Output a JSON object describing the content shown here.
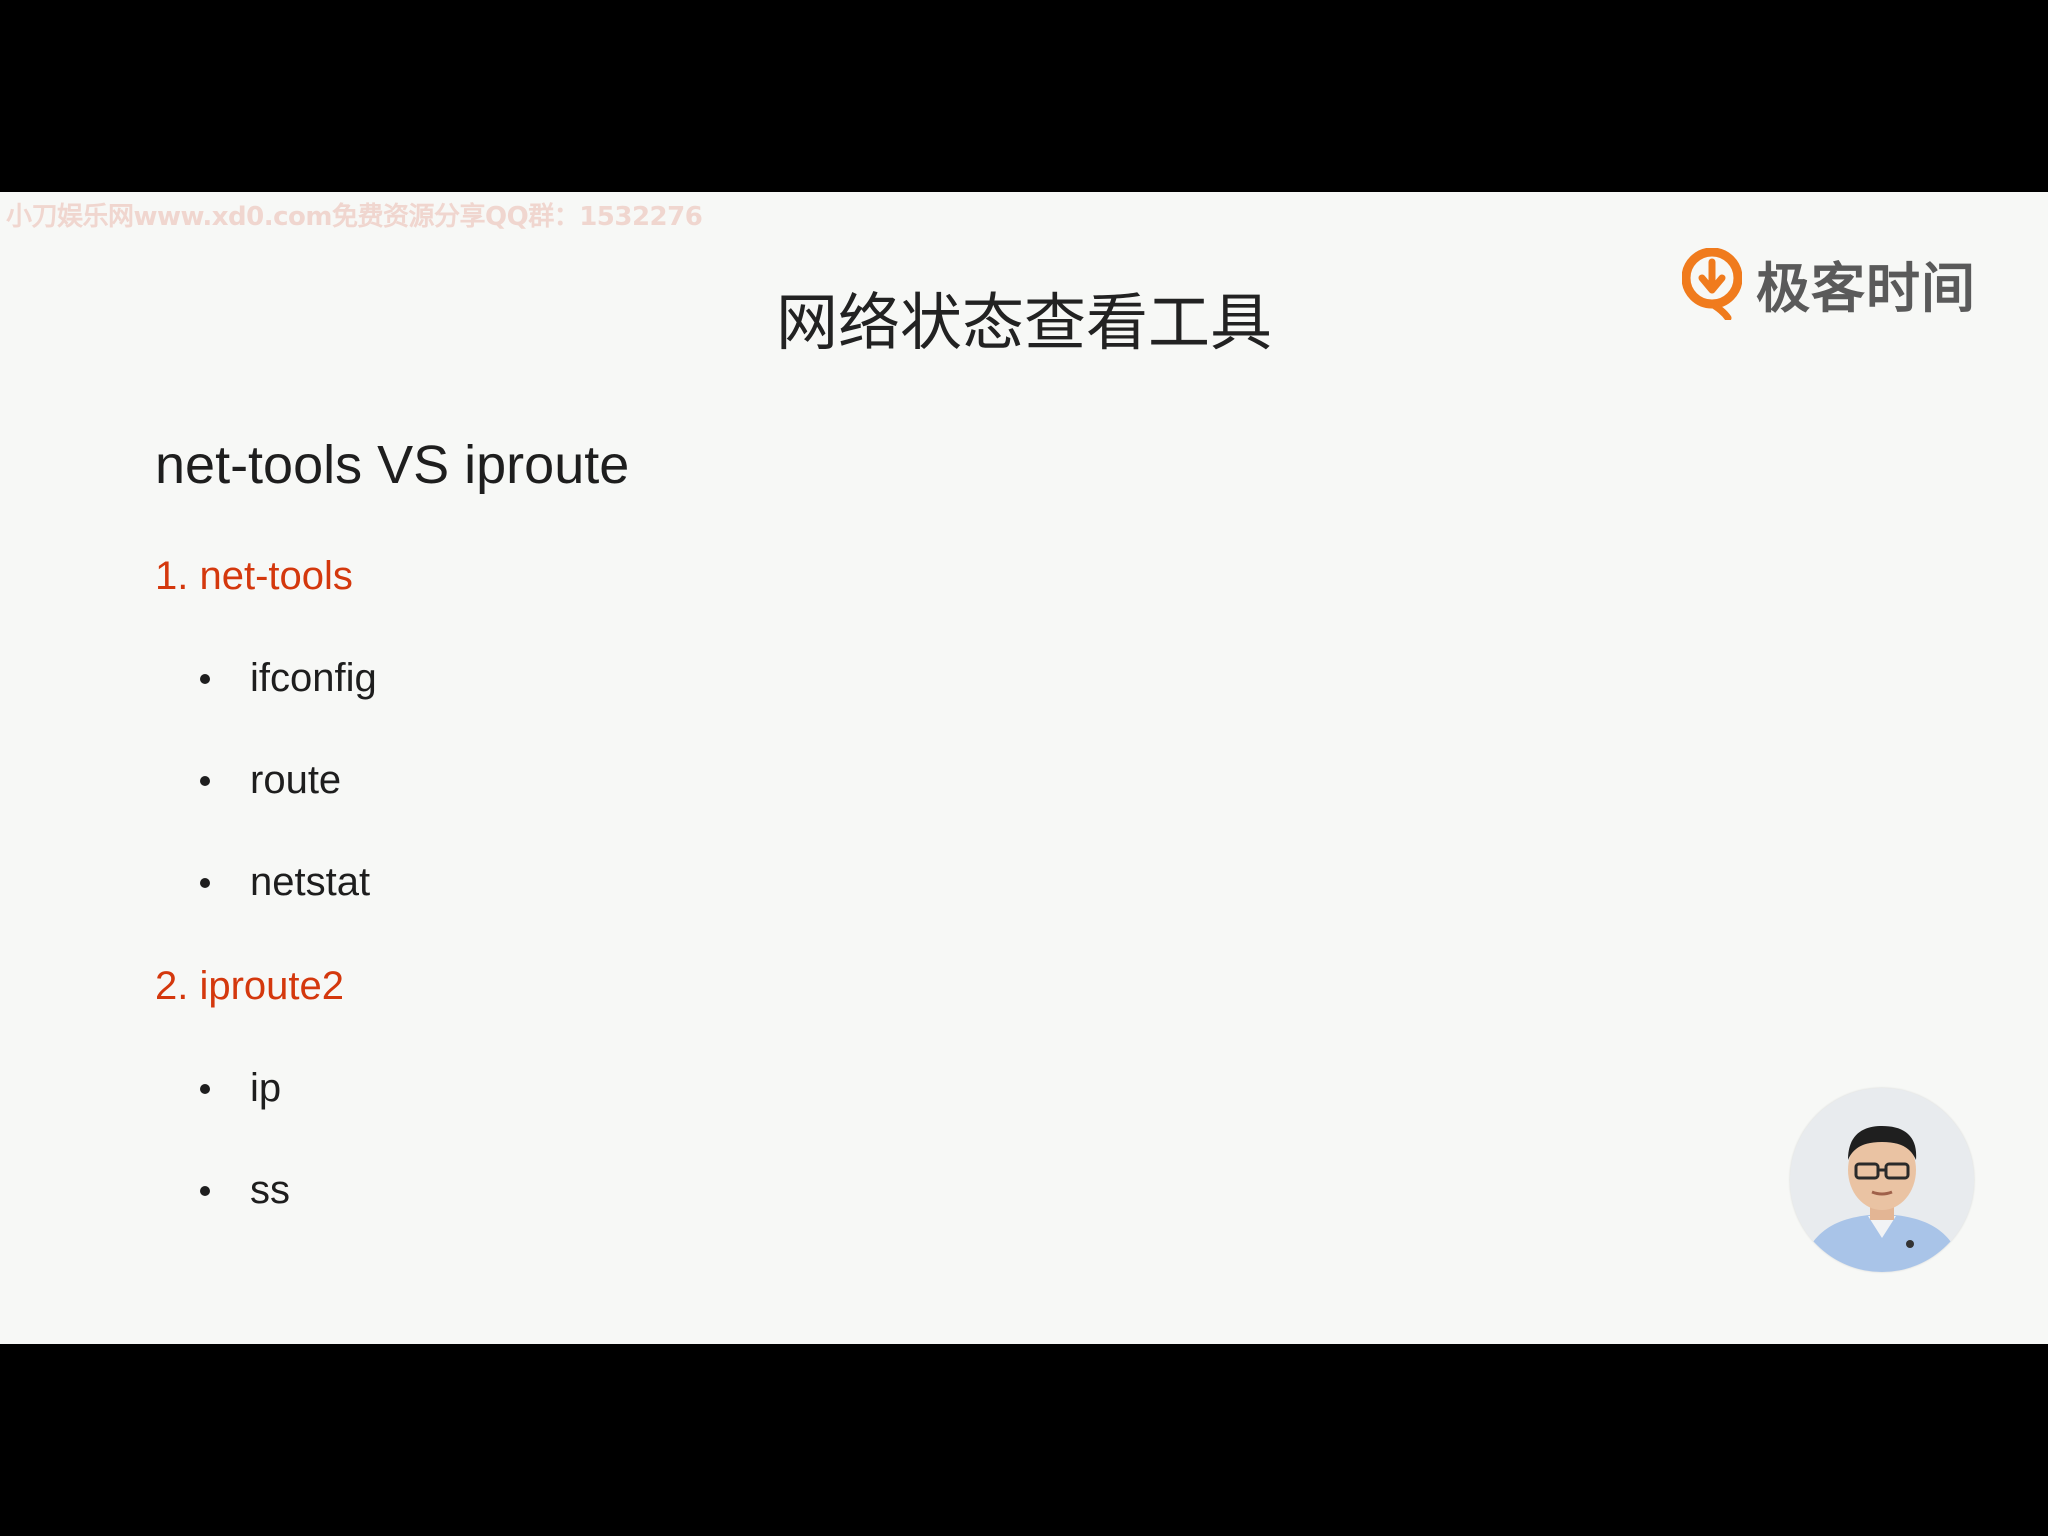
{
  "watermark": "小刀娱乐网www.xd0.com免费资源分享QQ群：1532276",
  "logo": {
    "text": "极客时间",
    "icon": "geektime-logo-icon",
    "colors": {
      "orange": "#f07b1d",
      "dark": "#5a5a5a"
    }
  },
  "slide": {
    "title": "网络状态查看工具",
    "subtitle": "net-tools VS iproute",
    "sections": [
      {
        "heading": "1. net-tools",
        "items": [
          "ifconfig",
          "route",
          "netstat"
        ]
      },
      {
        "heading": "2. iproute2",
        "items": [
          "ip",
          "ss"
        ]
      }
    ]
  },
  "presenter": {
    "icon": "presenter-video-avatar"
  },
  "colors": {
    "background": "#f7f8f6",
    "accent": "#d4380d",
    "text": "#1e1e1e",
    "letterbox": "#000000"
  }
}
